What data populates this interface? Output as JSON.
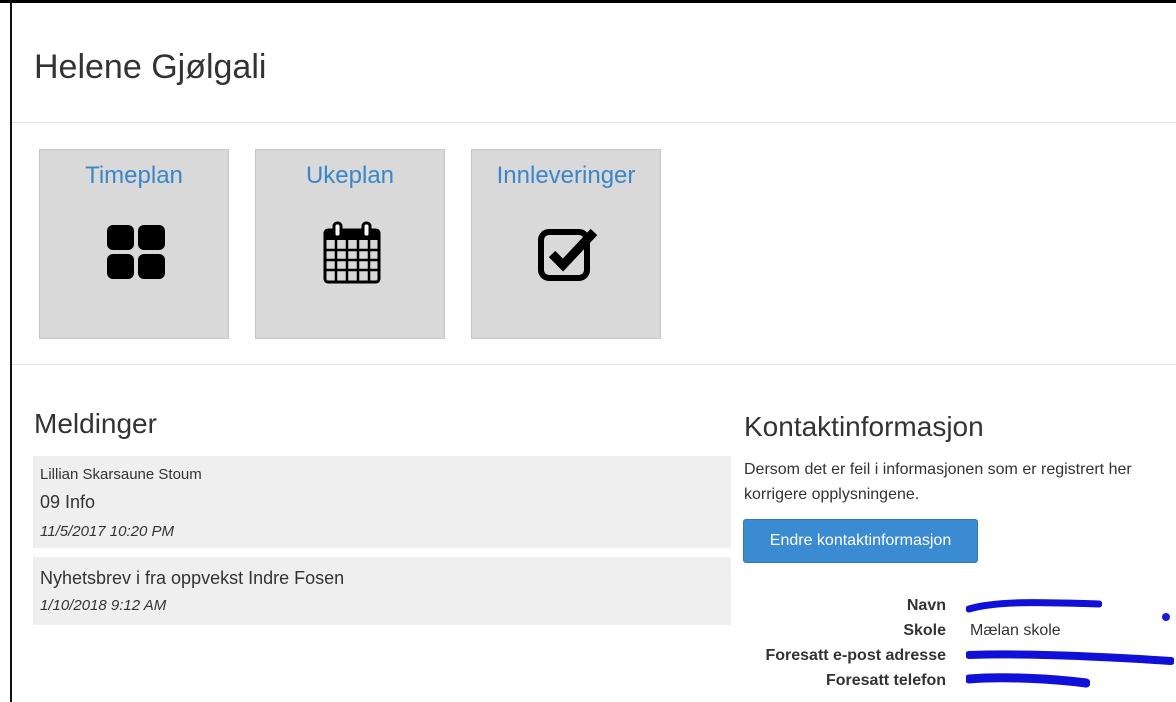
{
  "page": {
    "title": "Helene Gjølgali"
  },
  "tiles": [
    {
      "label": "Timeplan",
      "icon": "grid-icon"
    },
    {
      "label": "Ukeplan",
      "icon": "calendar-icon"
    },
    {
      "label": "Innleveringer",
      "icon": "checkbox-icon"
    }
  ],
  "messages": {
    "heading": "Meldinger",
    "items": [
      {
        "sender": "Lillian Skarsaune Stoum",
        "subject": "09 Info",
        "date": "11/5/2017 10:20 PM"
      },
      {
        "sender": "",
        "subject": "Nyhetsbrev i fra oppvekst Indre Fosen",
        "date": "1/10/2018 9:12 AM"
      }
    ]
  },
  "contact": {
    "heading": "Kontaktinformasjon",
    "description": "Dersom det er feil i informasjonen som er registrert her korrigere opplysningene.",
    "button_label": "Endre kontaktinformasjon",
    "fields": [
      {
        "label": "Navn",
        "value": "",
        "redacted": true
      },
      {
        "label": "Skole",
        "value": "Mælan skole",
        "redacted": false
      },
      {
        "label": "Foresatt e-post adresse",
        "value": "",
        "redacted": true
      },
      {
        "label": "Foresatt telefon",
        "value": "",
        "redacted": true
      }
    ],
    "redaction_color": "#1010d8"
  },
  "colors": {
    "link": "#3a87c8",
    "button": "#3a8bd1",
    "tile_bg": "#d9d9d9",
    "message_bg": "#efefef"
  }
}
